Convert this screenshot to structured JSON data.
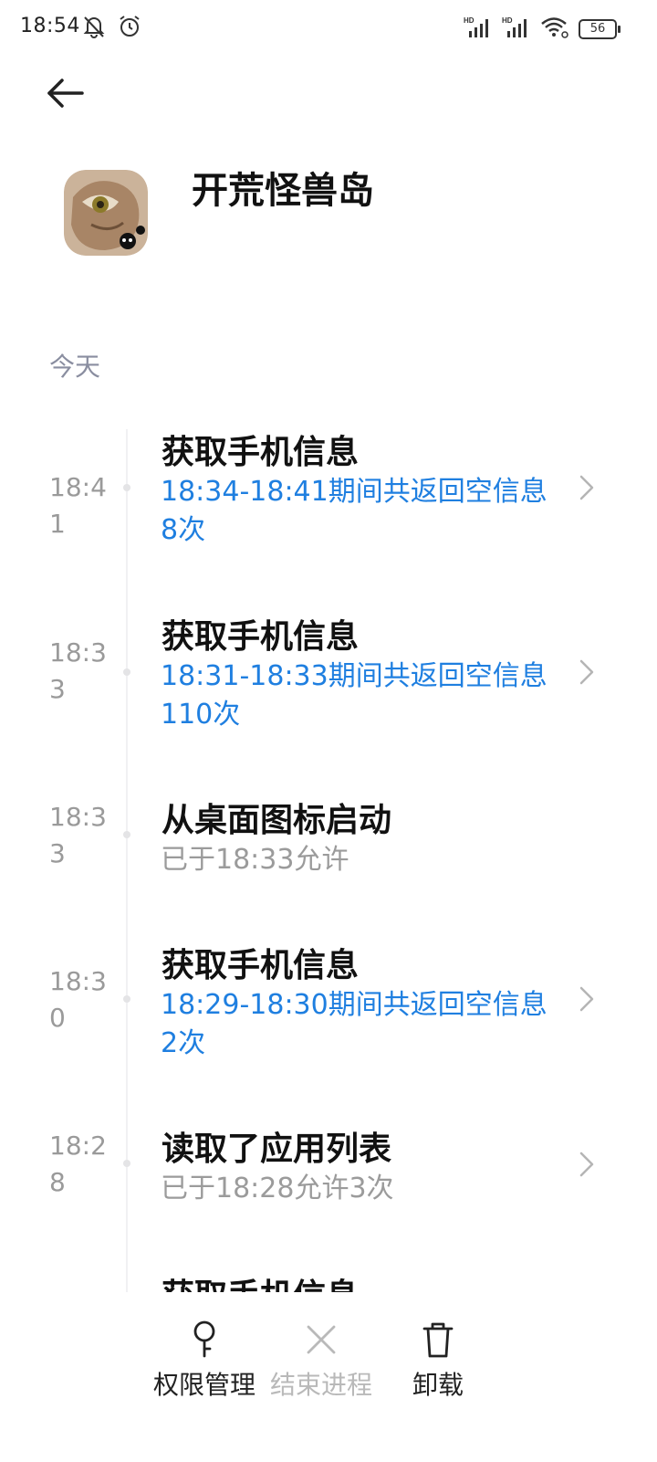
{
  "status_bar": {
    "time": "18:54",
    "icons": [
      "mute-icon",
      "alarm-icon",
      "signal-hd-icon",
      "signal-hd-icon",
      "wifi-icon",
      "battery-icon"
    ],
    "network_labels": [
      "HD",
      "HD"
    ],
    "battery": "56"
  },
  "header": {
    "back_icon": "back-arrow-icon",
    "app_name": "开荒怪兽岛"
  },
  "section": {
    "label": "今天"
  },
  "entries": [
    {
      "time": "18:41",
      "title": "获取手机信息",
      "detail": "18:34-18:41期间共返回空信息8次",
      "detail_color": "#1f7fe0",
      "has_chevron": true
    },
    {
      "time": "18:33",
      "title": "获取手机信息",
      "detail": "18:31-18:33期间共返回空信息110次",
      "detail_color": "#1f7fe0",
      "has_chevron": true
    },
    {
      "time": "18:33",
      "title": "从桌面图标启动",
      "detail": "已于18:33允许",
      "detail_color": "#9b9b9b",
      "has_chevron": false
    },
    {
      "time": "18:30",
      "title": "获取手机信息",
      "detail": "18:29-18:30期间共返回空信息2次",
      "detail_color": "#1f7fe0",
      "has_chevron": true
    },
    {
      "time": "18:28",
      "title": "读取了应用列表",
      "detail": "已于18:28允许3次",
      "detail_color": "#9b9b9b",
      "has_chevron": true
    },
    {
      "time": "",
      "title": "获取手机信息",
      "detail": "",
      "detail_color": "#9b9b9b",
      "has_chevron": false
    }
  ],
  "bottom_actions": [
    {
      "label": "权限管理",
      "icon": "key-icon",
      "enabled": true
    },
    {
      "label": "结束进程",
      "icon": "close-icon",
      "enabled": false
    },
    {
      "label": "卸载",
      "icon": "trash-icon",
      "enabled": true
    }
  ],
  "colors": {
    "accent_blue": "#1f7fe0",
    "muted_gray": "#9b9b9b",
    "section_gray": "#8a8ea0"
  }
}
